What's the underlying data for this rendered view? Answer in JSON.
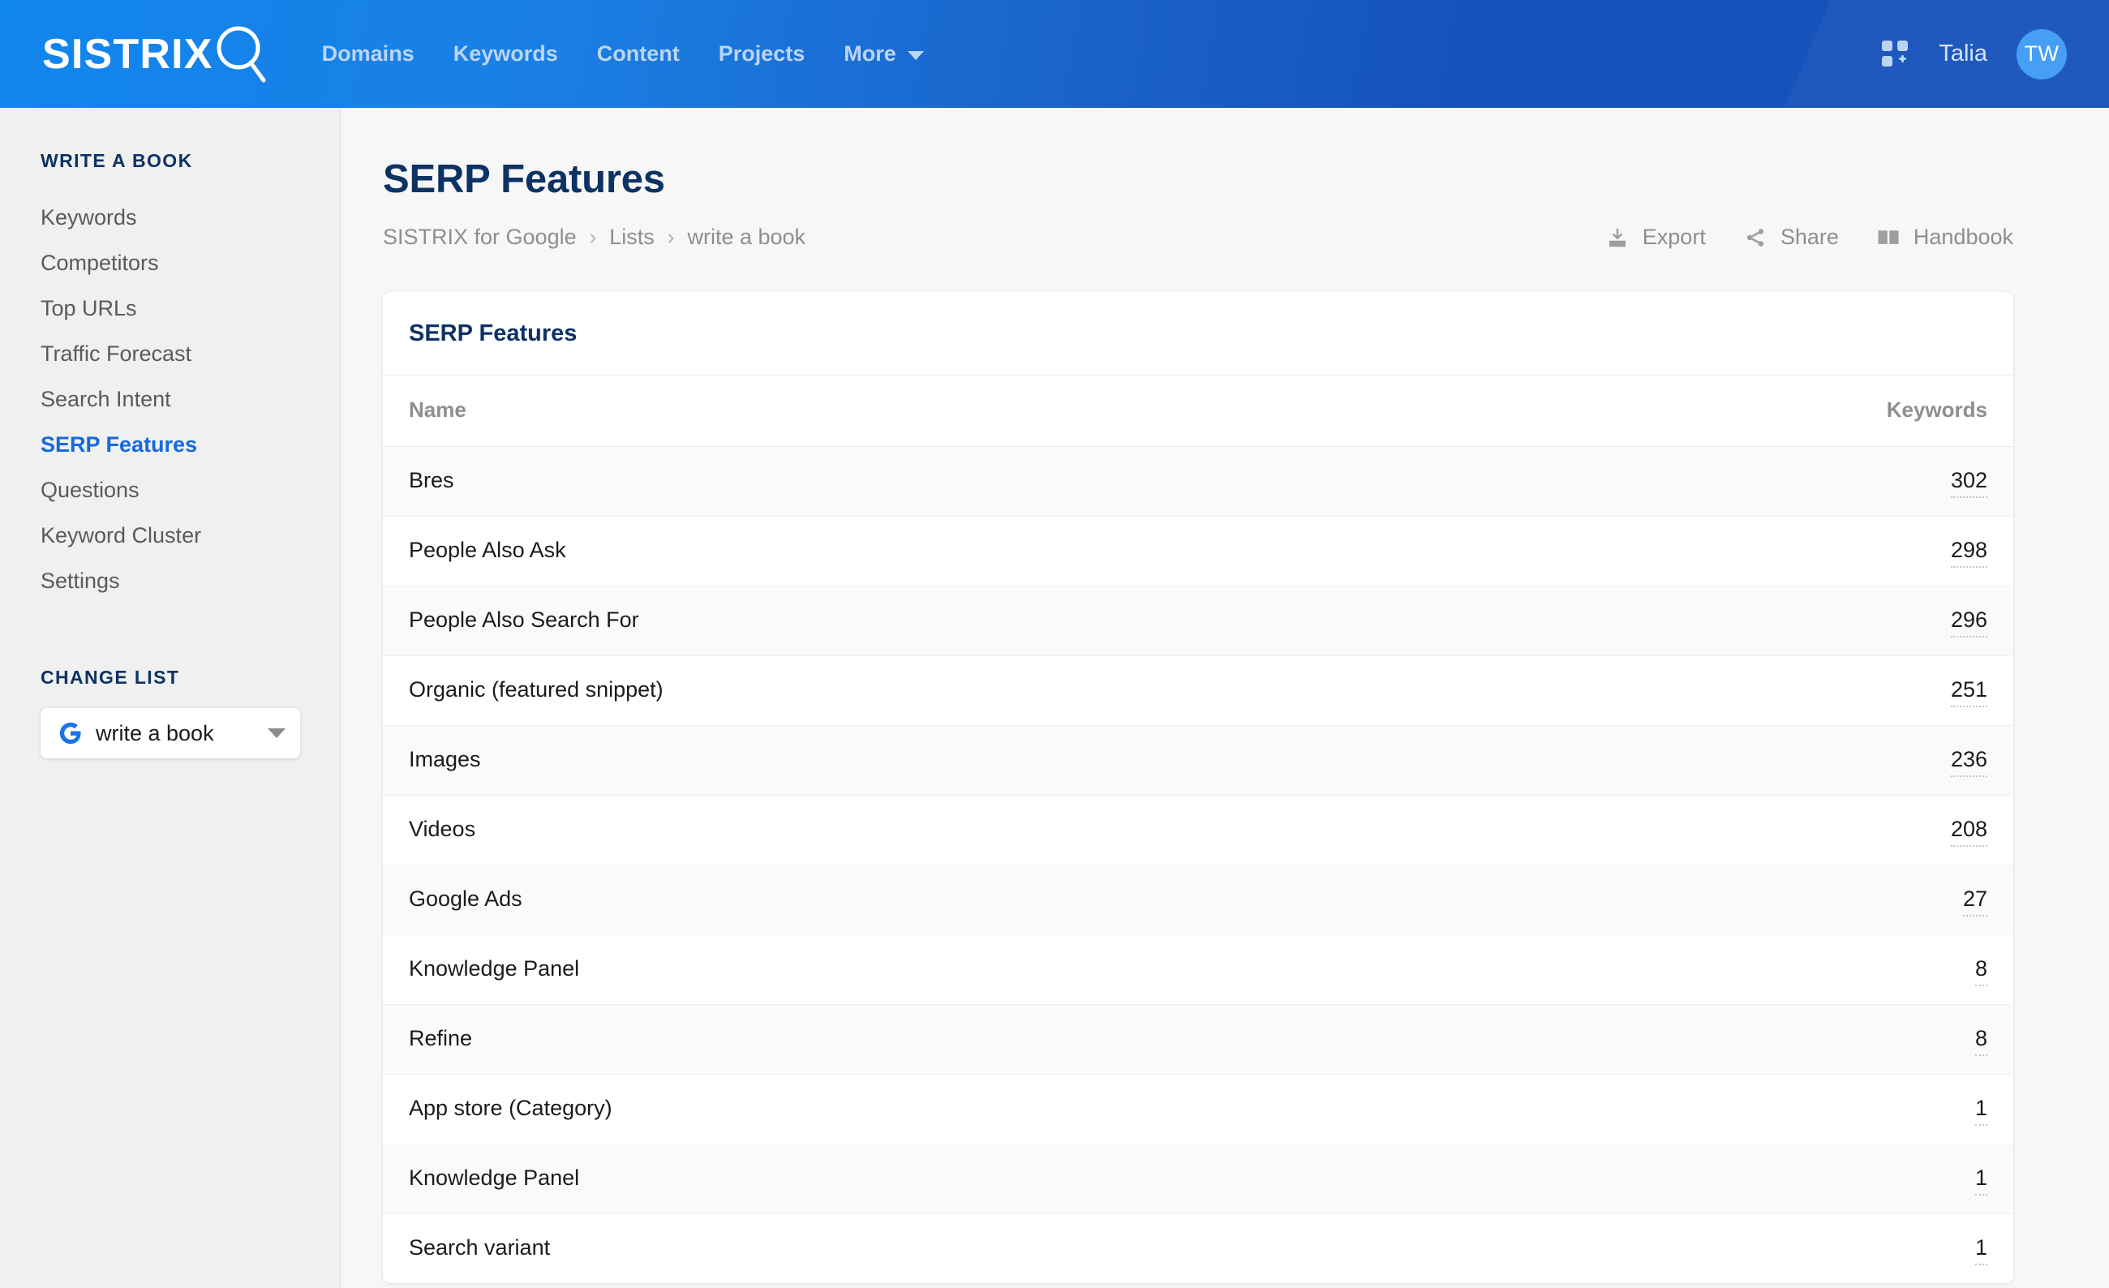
{
  "topbar": {
    "logo_text": "SISTRIX",
    "logo_icon": "magnifier-icon",
    "nav": [
      {
        "label": "Domains"
      },
      {
        "label": "Keywords"
      },
      {
        "label": "Content"
      },
      {
        "label": "Projects"
      },
      {
        "label": "More",
        "has_caret": true
      }
    ],
    "apps_icon": "apps-grid-icon",
    "username": "Talia",
    "avatar_initials": "TW",
    "colors": {
      "left": "#1186ee",
      "right": "#1552bb",
      "avatar": "#3e9bf4",
      "nav_text": "#bcd5f4"
    }
  },
  "sidebar": {
    "section_title": "WRITE A BOOK",
    "items": [
      {
        "label": "Keywords",
        "active": false
      },
      {
        "label": "Competitors",
        "active": false
      },
      {
        "label": "Top URLs",
        "active": false
      },
      {
        "label": "Traffic Forecast",
        "active": false
      },
      {
        "label": "Search Intent",
        "active": false
      },
      {
        "label": "SERP Features",
        "active": true
      },
      {
        "label": "Questions",
        "active": false
      },
      {
        "label": "Keyword Cluster",
        "active": false
      },
      {
        "label": "Settings",
        "active": false
      }
    ],
    "change_list_title": "CHANGE LIST",
    "change_list_value": "write a book",
    "change_list_icon": "google-g-icon"
  },
  "main": {
    "page_title": "SERP Features",
    "breadcrumb": [
      {
        "label": "SISTRIX for Google"
      },
      {
        "label": "Lists"
      },
      {
        "label": "write a book"
      }
    ],
    "breadcrumb_separator": "›",
    "actions": [
      {
        "label": "Export",
        "icon": "download-icon"
      },
      {
        "label": "Share",
        "icon": "share-nodes-icon"
      },
      {
        "label": "Handbook",
        "icon": "book-icon"
      }
    ],
    "card": {
      "title": "SERP Features",
      "columns": [
        {
          "key": "name",
          "label": "Name",
          "align": "left"
        },
        {
          "key": "keywords",
          "label": "Keywords",
          "align": "right"
        }
      ],
      "rows": [
        {
          "name": "Bres",
          "keywords": "302"
        },
        {
          "name": "People Also Ask",
          "keywords": "298"
        },
        {
          "name": "People Also Search For",
          "keywords": "296"
        },
        {
          "name": "Organic (featured snippet)",
          "keywords": "251"
        },
        {
          "name": "Images",
          "keywords": "236"
        },
        {
          "name": "Videos",
          "keywords": "208"
        },
        {
          "name": "Google Ads",
          "keywords": "27"
        },
        {
          "name": "Knowledge Panel",
          "keywords": "8"
        },
        {
          "name": "Refine",
          "keywords": "8"
        },
        {
          "name": "App store (Category)",
          "keywords": "1"
        },
        {
          "name": "Knowledge Panel",
          "keywords": "1"
        },
        {
          "name": "Search variant",
          "keywords": "1"
        }
      ]
    }
  }
}
